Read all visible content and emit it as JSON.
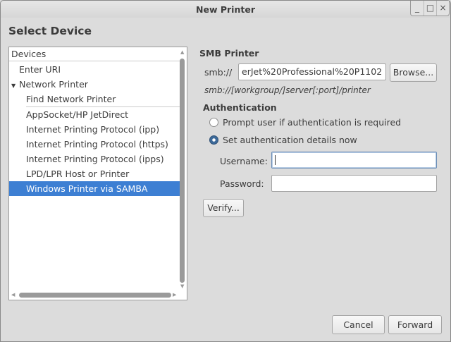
{
  "window": {
    "title": "New Printer",
    "controls": [
      "_",
      "□",
      "×"
    ]
  },
  "page_title": "Select Device",
  "devices": {
    "header": "Devices",
    "items": [
      {
        "label": "Enter URI",
        "indent": 1
      },
      {
        "label": "Network Printer",
        "indent": 0,
        "expander": "▼"
      },
      {
        "label": "Find Network Printer",
        "indent": 2
      },
      {
        "label": "AppSocket/HP JetDirect",
        "indent": 2
      },
      {
        "label": "Internet Printing Protocol (ipp)",
        "indent": 2
      },
      {
        "label": "Internet Printing Protocol (https)",
        "indent": 2
      },
      {
        "label": "Internet Printing Protocol (ipps)",
        "indent": 2
      },
      {
        "label": "LPD/LPR Host or Printer",
        "indent": 2
      },
      {
        "label": "Windows Printer via SAMBA",
        "indent": 2,
        "selected": true
      }
    ]
  },
  "smb": {
    "heading": "SMB Printer",
    "prefix": "smb://",
    "uri_value": "erJet%20Professional%20P1102",
    "browse_label": "Browse...",
    "hint": "smb://[workgroup/]server[:port]/printer"
  },
  "auth": {
    "heading": "Authentication",
    "option_prompt": "Prompt user if authentication is required",
    "option_set": "Set authentication details now",
    "selected": "set",
    "username_label": "Username:",
    "username_value": "",
    "password_label": "Password:",
    "password_value": "",
    "verify_label": "Verify..."
  },
  "footer": {
    "cancel_label": "Cancel",
    "forward_label": "Forward"
  },
  "colors": {
    "selection": "#3d7fd3",
    "background": "#dcdcdc"
  }
}
